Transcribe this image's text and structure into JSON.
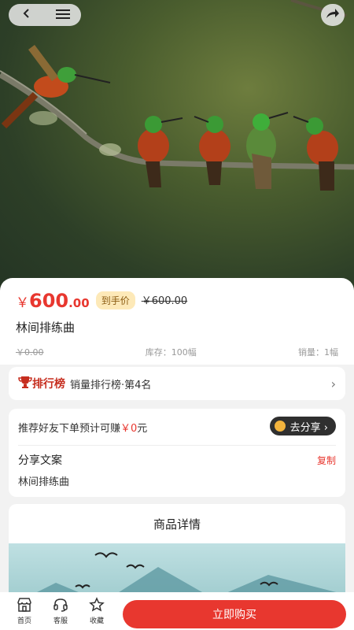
{
  "nav": {
    "back_icon": "chevron-left-icon",
    "menu_icon": "hamburger-menu-icon",
    "share_icon": "share-arrow-icon"
  },
  "product": {
    "currency_symbol": "￥",
    "price_int": "600",
    "price_dec": ".00",
    "handprice_tag": "到手价",
    "original_price": "￥600.00",
    "title": "林间排练曲",
    "market_price": "￥0.00",
    "stock": "库存：100幅",
    "sales": "销量：1幅"
  },
  "ranking": {
    "badge": "排行榜",
    "text": "销量排行榜·第4名"
  },
  "share": {
    "recommend_prefix": "推荐好友下单预计可赚",
    "recommend_amount": "￥0",
    "recommend_suffix": "元",
    "go_share_label": "去分享 ›",
    "copy_title": "分享文案",
    "copy_button": "复制",
    "copy_text": "林间排练曲"
  },
  "detail": {
    "title": "商品详情"
  },
  "bottom_nav": {
    "home_label": "首页",
    "service_label": "客服",
    "favorite_label": "收藏",
    "buy_label": "立即购买"
  },
  "colors": {
    "accent": "#e8372f",
    "tag_bg": "#fde9b8"
  }
}
